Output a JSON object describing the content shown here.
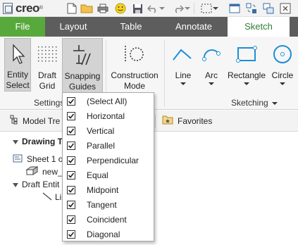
{
  "app": {
    "logo_text": "creo",
    "logo_mark": "®"
  },
  "quick_access": [
    {
      "icon": "new-file-icon"
    },
    {
      "icon": "open-folder-icon"
    },
    {
      "icon": "print-icon"
    },
    {
      "icon": "smiley-icon"
    },
    {
      "icon": "save-icon"
    },
    {
      "icon": "undo-icon"
    },
    {
      "icon": "redo-icon"
    },
    {
      "icon": "select-box-icon"
    },
    {
      "icon": "window-icon"
    },
    {
      "icon": "regenerate-icon"
    },
    {
      "icon": "switch-windows-icon"
    },
    {
      "icon": "close-window-icon"
    }
  ],
  "tabs": {
    "file": "File",
    "layout": "Layout",
    "table": "Table",
    "annotate": "Annotate",
    "sketch": "Sketch"
  },
  "ribbon": {
    "entity_select": "Entity\nSelect",
    "draft_grid": "Draft\nGrid",
    "snapping_guides": "Snapping\nGuides",
    "construction_mode": "Construction\nMode",
    "line": "Line",
    "arc": "Arc",
    "rectangle": "Rectangle",
    "circle": "Circle",
    "settings_group": "Settings",
    "sketching_group": "Sketching"
  },
  "navigator": {
    "model_tree_tab": "Model Tre",
    "favorites_tab": "Favorites",
    "drawing_tree": "Drawing T",
    "sheet": "Sheet 1 o",
    "model": "new_",
    "draft_entities": "Draft Entit",
    "line_entity": "Li"
  },
  "snapping_menu": {
    "items": [
      {
        "label": "(Select All)",
        "checked": true
      },
      {
        "label": "Horizontal",
        "checked": true
      },
      {
        "label": "Vertical",
        "checked": true
      },
      {
        "label": "Parallel",
        "checked": true
      },
      {
        "label": "Perpendicular",
        "checked": true
      },
      {
        "label": "Equal",
        "checked": true
      },
      {
        "label": "Midpoint",
        "checked": true
      },
      {
        "label": "Tangent",
        "checked": true
      },
      {
        "label": "Coincident",
        "checked": true
      },
      {
        "label": "Diagonal",
        "checked": true
      }
    ]
  },
  "colors": {
    "file_tab": "#58a93c",
    "active_tab_text": "#2e7d32",
    "tab_bar": "#5d5d5d",
    "sketch_icon": "#1d8fd6"
  }
}
